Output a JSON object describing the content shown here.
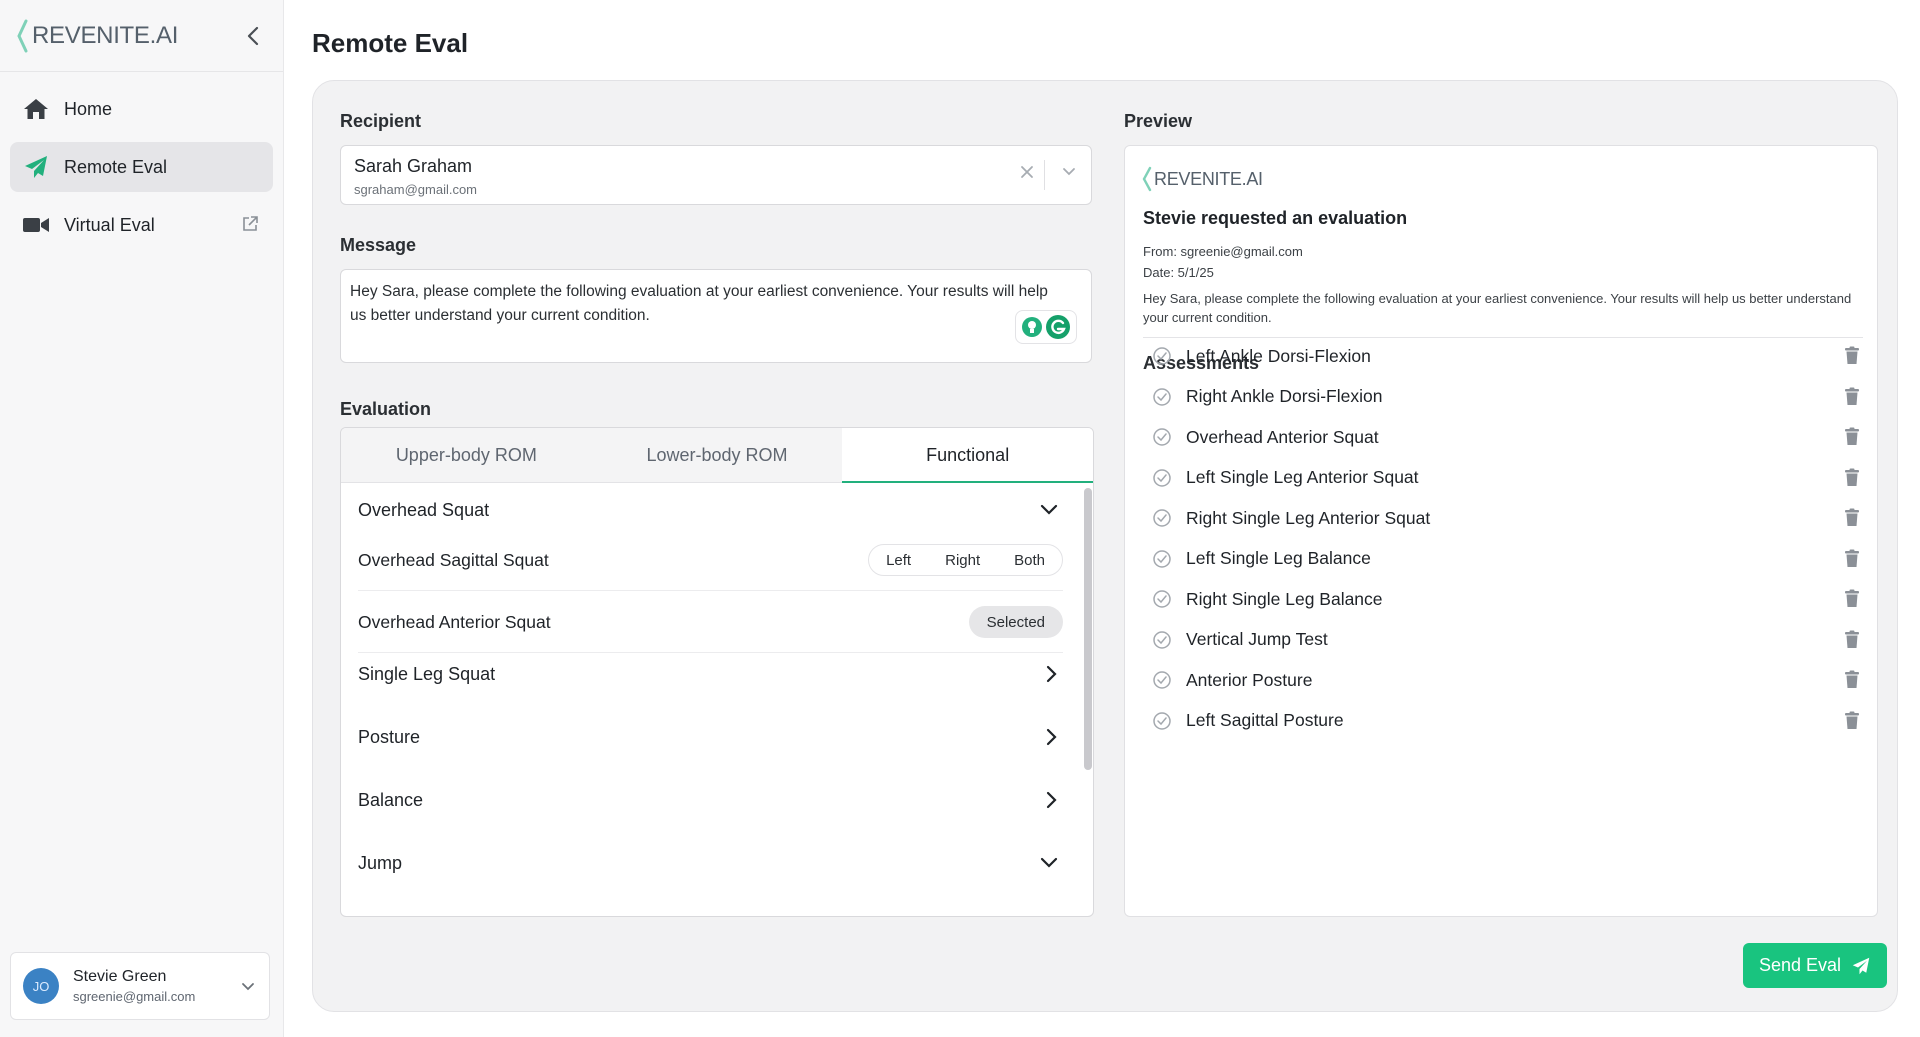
{
  "app": {
    "logo_text": "REVENITE.AI"
  },
  "sidebar": {
    "items": [
      {
        "label": "Home",
        "icon": "home-icon"
      },
      {
        "label": "Remote Eval",
        "icon": "paper-plane-icon"
      },
      {
        "label": "Virtual Eval",
        "icon": "video-camera-icon"
      }
    ],
    "user": {
      "initials": "JO",
      "name": "Stevie Green",
      "email": "sgreenie@gmail.com"
    }
  },
  "page": {
    "title": "Remote Eval"
  },
  "form": {
    "recipient_label": "Recipient",
    "recipient_name": "Sarah Graham",
    "recipient_email": "sgraham@gmail.com",
    "message_label": "Message",
    "message_text": "Hey Sara, please complete the following evaluation at your earliest convenience. Your results will help us better understand your current condition.",
    "evaluation_label": "Evaluation"
  },
  "evaluation": {
    "tabs": [
      "Upper-body ROM",
      "Lower-body ROM",
      "Functional"
    ],
    "active_tab": "Functional",
    "groups": [
      {
        "name": "Overhead Squat",
        "expanded": true
      },
      {
        "name": "Single Leg Squat",
        "expanded": false
      },
      {
        "name": "Posture",
        "expanded": false
      },
      {
        "name": "Balance",
        "expanded": false
      },
      {
        "name": "Jump",
        "expanded": true
      }
    ],
    "exercises": [
      {
        "name": "Overhead Sagittal Squat",
        "options": [
          "Left",
          "Right",
          "Both"
        ]
      },
      {
        "name": "Overhead Anterior Squat",
        "status": "Selected"
      }
    ]
  },
  "preview": {
    "label": "Preview",
    "logo_text": "REVENITE.AI",
    "heading": "Stevie requested an evaluation",
    "from": "From: sgreenie@gmail.com",
    "date": "Date: 5/1/25",
    "message": "Hey Sara, please complete the following evaluation at your earliest convenience. Your results will help us better understand your current condition.",
    "assessments_title": "Assessments",
    "assessments": [
      "Left Ankle Dorsi-Flexion",
      "Right Ankle Dorsi-Flexion",
      "Overhead Anterior Squat",
      "Left Single Leg Anterior Squat",
      "Right Single Leg Anterior Squat",
      "Left Single Leg Balance",
      "Right Single Leg Balance",
      "Vertical Jump Test",
      "Anterior Posture",
      "Left Sagittal Posture"
    ]
  },
  "actions": {
    "send_label": "Send Eval"
  },
  "colors": {
    "accent": "#19c47f",
    "tab_underline": "#22b07d",
    "avatar": "#3b82c4"
  }
}
